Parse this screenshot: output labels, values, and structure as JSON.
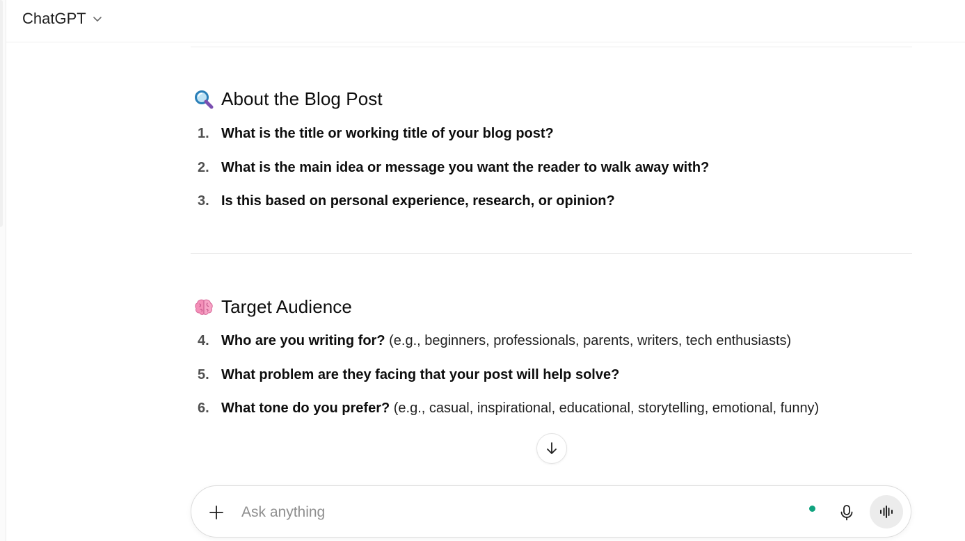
{
  "app": {
    "model_name": "ChatGPT"
  },
  "sections": [
    {
      "emoji": "magnifier-icon",
      "title": "About the Blog Post",
      "items": [
        {
          "num": "1.",
          "bold": "What is the title or working title of your blog post?",
          "hint": ""
        },
        {
          "num": "2.",
          "bold": "What is the main idea or message you want the reader to walk away with?",
          "hint": ""
        },
        {
          "num": "3.",
          "bold": "Is this based on personal experience, research, or opinion?",
          "hint": ""
        }
      ]
    },
    {
      "emoji": "brain-icon",
      "title": "Target Audience",
      "items": [
        {
          "num": "4.",
          "bold": "Who are you writing for?",
          "hint": " (e.g., beginners, professionals, parents, writers, tech enthusiasts)"
        },
        {
          "num": "5.",
          "bold": "What problem are they facing that your post will help solve?",
          "hint": ""
        },
        {
          "num": "6.",
          "bold": "What tone do you prefer?",
          "hint": " (e.g., casual, inspirational, educational, storytelling, emotional, funny)"
        }
      ]
    }
  ],
  "composer": {
    "placeholder": "Ask anything",
    "status_color": "#10a37f"
  },
  "icons": {
    "plus": "plus-icon",
    "mic": "microphone-icon",
    "voice": "voice-mode-icon",
    "scroll": "arrow-down-icon",
    "chevron": "chevron-down-icon"
  }
}
